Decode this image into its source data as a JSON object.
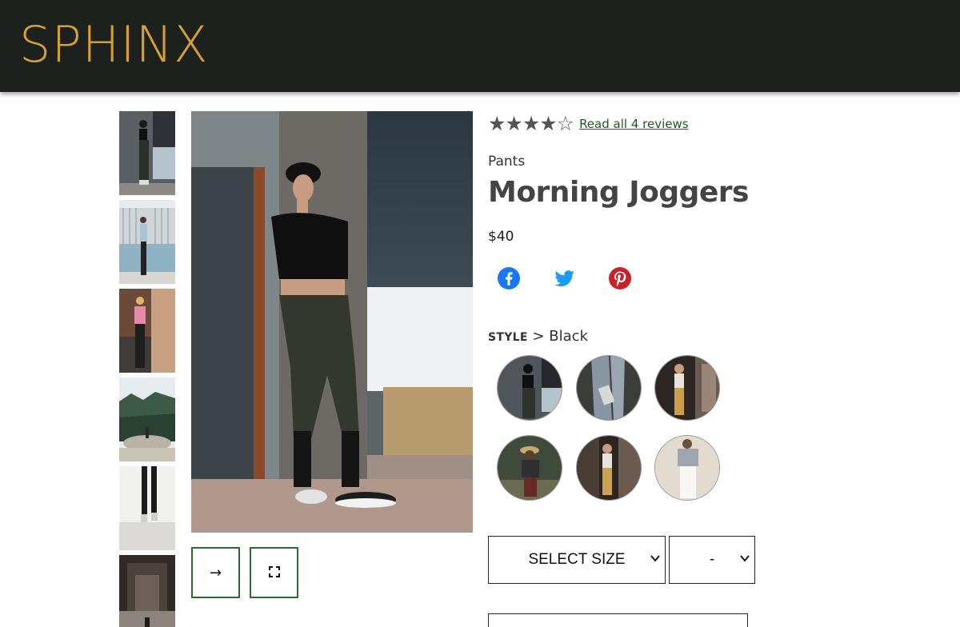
{
  "brand": {
    "name": "SPHINX",
    "color": "#d9a02e"
  },
  "gallery": {
    "thumbnails": [
      "thumbnail-1",
      "thumbnail-2",
      "thumbnail-3",
      "thumbnail-4",
      "thumbnail-5",
      "thumbnail-6"
    ],
    "next_icon": "→",
    "expand_icon": "⛶"
  },
  "product": {
    "rating": 4,
    "rating_max": 5,
    "stars": "★★★★☆",
    "reviews_link": "Read all 4 reviews",
    "category": "Pants",
    "name": "Morning Joggers",
    "price": "$40"
  },
  "social": [
    "facebook-icon",
    "twitter-icon",
    "pinterest-icon"
  ],
  "style": {
    "label": "STYLE",
    "separator": " > ",
    "selected": "Black",
    "swatches": [
      "black",
      "grey",
      "mustard",
      "burgundy",
      "tan",
      "white"
    ]
  },
  "size_select": {
    "label": "SELECT SIZE",
    "chevron": "⌄"
  },
  "qty_select": {
    "label": "-",
    "chevron": "⌄"
  },
  "colors": {
    "header_bg": "#1c211e",
    "accent_green": "#2e6b2e",
    "link_green": "#1a5c1a"
  }
}
